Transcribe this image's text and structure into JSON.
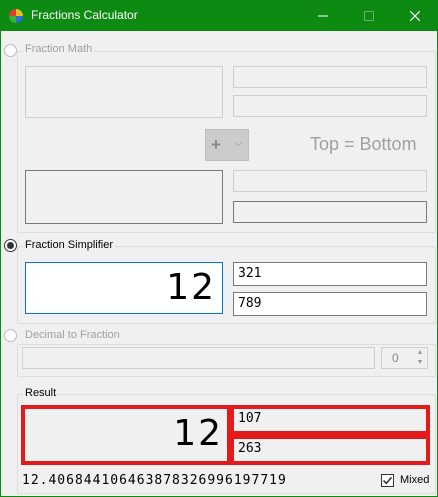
{
  "window": {
    "title": "Fractions Calculator"
  },
  "sections": {
    "fraction_math": {
      "label": "Fraction Math",
      "operator": "+",
      "equation_label": "Top = Bottom"
    },
    "fraction_simplifier": {
      "label": "Fraction Simplifier",
      "whole": "12",
      "numerator": "321",
      "denominator": "789"
    },
    "decimal_to_fraction": {
      "label": "Decimal to Fraction",
      "input": "",
      "precision": "0"
    },
    "result": {
      "label": "Result",
      "whole": "12",
      "numerator": "107",
      "denominator": "263",
      "decimal": "12.406844106463878326996197719",
      "mixed_label": "Mixed",
      "mixed_checked": true
    }
  }
}
